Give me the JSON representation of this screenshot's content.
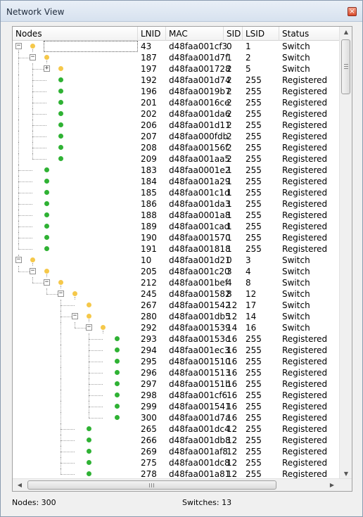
{
  "window": {
    "title": "Network View",
    "close_glyph": "×"
  },
  "columns": [
    {
      "key": "nodes",
      "label": "Nodes"
    },
    {
      "key": "lnid",
      "label": "LNID"
    },
    {
      "key": "mac",
      "label": "MAC"
    },
    {
      "key": "sid",
      "label": "SID"
    },
    {
      "key": "lsid",
      "label": "LSID"
    },
    {
      "key": "status",
      "label": "Status"
    }
  ],
  "colors": {
    "switch_dot": "#f5c84a",
    "registered_dot": "#2fb234"
  },
  "rows": [
    {
      "depth": 0,
      "toggle": "minus",
      "lnid": "43",
      "mac": "d48faa001cf3",
      "sid": "0",
      "lsid": "1",
      "status": "Switch"
    },
    {
      "depth": 1,
      "toggle": "minus",
      "lnid": "187",
      "mac": "d48faa001d7f",
      "sid": "1",
      "lsid": "2",
      "status": "Switch"
    },
    {
      "depth": 2,
      "toggle": "plus",
      "lnid": "197",
      "mac": "d48faa001728",
      "sid": "2",
      "lsid": "5",
      "status": "Switch"
    },
    {
      "depth": 2,
      "toggle": "",
      "lnid": "192",
      "mac": "d48faa001d74",
      "sid": "2",
      "lsid": "255",
      "status": "Registered"
    },
    {
      "depth": 2,
      "toggle": "",
      "lnid": "196",
      "mac": "d48faa0019b7",
      "sid": "2",
      "lsid": "255",
      "status": "Registered"
    },
    {
      "depth": 2,
      "toggle": "",
      "lnid": "201",
      "mac": "d48faa0016ce",
      "sid": "2",
      "lsid": "255",
      "status": "Registered"
    },
    {
      "depth": 2,
      "toggle": "",
      "lnid": "202",
      "mac": "d48faa001da6",
      "sid": "2",
      "lsid": "255",
      "status": "Registered"
    },
    {
      "depth": 2,
      "toggle": "",
      "lnid": "206",
      "mac": "d48faa001d11",
      "sid": "2",
      "lsid": "255",
      "status": "Registered"
    },
    {
      "depth": 2,
      "toggle": "",
      "lnid": "207",
      "mac": "d48faa000fdb",
      "sid": "2",
      "lsid": "255",
      "status": "Registered"
    },
    {
      "depth": 2,
      "toggle": "",
      "lnid": "208",
      "mac": "d48faa00156f",
      "sid": "2",
      "lsid": "255",
      "status": "Registered"
    },
    {
      "depth": 2,
      "toggle": "",
      "lnid": "209",
      "mac": "d48faa001aa5",
      "sid": "2",
      "lsid": "255",
      "status": "Registered"
    },
    {
      "depth": 1,
      "toggle": "",
      "lnid": "183",
      "mac": "d48faa0001e2",
      "sid": "1",
      "lsid": "255",
      "status": "Registered"
    },
    {
      "depth": 1,
      "toggle": "",
      "lnid": "184",
      "mac": "d48faa001a29",
      "sid": "1",
      "lsid": "255",
      "status": "Registered"
    },
    {
      "depth": 1,
      "toggle": "",
      "lnid": "185",
      "mac": "d48faa001c1d",
      "sid": "1",
      "lsid": "255",
      "status": "Registered"
    },
    {
      "depth": 1,
      "toggle": "",
      "lnid": "186",
      "mac": "d48faa001da3",
      "sid": "1",
      "lsid": "255",
      "status": "Registered"
    },
    {
      "depth": 1,
      "toggle": "",
      "lnid": "188",
      "mac": "d48faa0001a8",
      "sid": "1",
      "lsid": "255",
      "status": "Registered"
    },
    {
      "depth": 1,
      "toggle": "",
      "lnid": "189",
      "mac": "d48faa001cad",
      "sid": "1",
      "lsid": "255",
      "status": "Registered"
    },
    {
      "depth": 1,
      "toggle": "",
      "lnid": "190",
      "mac": "d48faa001570",
      "sid": "1",
      "lsid": "255",
      "status": "Registered"
    },
    {
      "depth": 1,
      "toggle": "",
      "lnid": "191",
      "mac": "d48faa001818",
      "sid": "1",
      "lsid": "255",
      "status": "Registered"
    },
    {
      "depth": 0,
      "toggle": "minus",
      "lnid": "10",
      "mac": "d48faa001d21",
      "sid": "0",
      "lsid": "3",
      "status": "Switch"
    },
    {
      "depth": 1,
      "toggle": "minus",
      "lnid": "205",
      "mac": "d48faa001c20",
      "sid": "3",
      "lsid": "4",
      "status": "Switch"
    },
    {
      "depth": 2,
      "toggle": "minus",
      "lnid": "212",
      "mac": "d48faa001bef",
      "sid": "4",
      "lsid": "8",
      "status": "Switch"
    },
    {
      "depth": 3,
      "toggle": "minus",
      "lnid": "245",
      "mac": "d48faa001582",
      "sid": "8",
      "lsid": "12",
      "status": "Switch"
    },
    {
      "depth": 4,
      "toggle": "",
      "lnid": "267",
      "mac": "d48faa001542",
      "sid": "12",
      "lsid": "17",
      "status": "Switch"
    },
    {
      "depth": 4,
      "toggle": "minus",
      "lnid": "280",
      "mac": "d48faa001db5",
      "sid": "12",
      "lsid": "14",
      "status": "Switch"
    },
    {
      "depth": 5,
      "toggle": "minus",
      "lnid": "292",
      "mac": "d48faa001539",
      "sid": "14",
      "lsid": "16",
      "status": "Switch"
    },
    {
      "depth": 6,
      "toggle": "",
      "lnid": "293",
      "mac": "d48faa00153d",
      "sid": "16",
      "lsid": "255",
      "status": "Registered"
    },
    {
      "depth": 6,
      "toggle": "",
      "lnid": "294",
      "mac": "d48faa001ec3",
      "sid": "16",
      "lsid": "255",
      "status": "Registered"
    },
    {
      "depth": 6,
      "toggle": "",
      "lnid": "295",
      "mac": "d48faa001510",
      "sid": "16",
      "lsid": "255",
      "status": "Registered"
    },
    {
      "depth": 6,
      "toggle": "",
      "lnid": "296",
      "mac": "d48faa001513",
      "sid": "16",
      "lsid": "255",
      "status": "Registered"
    },
    {
      "depth": 6,
      "toggle": "",
      "lnid": "297",
      "mac": "d48faa00151b",
      "sid": "16",
      "lsid": "255",
      "status": "Registered"
    },
    {
      "depth": 6,
      "toggle": "",
      "lnid": "298",
      "mac": "d48faa001cf6",
      "sid": "16",
      "lsid": "255",
      "status": "Registered"
    },
    {
      "depth": 6,
      "toggle": "",
      "lnid": "299",
      "mac": "d48faa001541",
      "sid": "16",
      "lsid": "255",
      "status": "Registered"
    },
    {
      "depth": 6,
      "toggle": "",
      "lnid": "300",
      "mac": "d48faa001d7a",
      "sid": "16",
      "lsid": "255",
      "status": "Registered"
    },
    {
      "depth": 4,
      "toggle": "",
      "lnid": "265",
      "mac": "d48faa001dc4",
      "sid": "12",
      "lsid": "255",
      "status": "Registered"
    },
    {
      "depth": 4,
      "toggle": "",
      "lnid": "266",
      "mac": "d48faa001db8",
      "sid": "12",
      "lsid": "255",
      "status": "Registered"
    },
    {
      "depth": 4,
      "toggle": "",
      "lnid": "269",
      "mac": "d48faa001af8",
      "sid": "12",
      "lsid": "255",
      "status": "Registered"
    },
    {
      "depth": 4,
      "toggle": "",
      "lnid": "275",
      "mac": "d48faa001dc8",
      "sid": "12",
      "lsid": "255",
      "status": "Registered"
    },
    {
      "depth": 4,
      "toggle": "",
      "lnid": "278",
      "mac": "d48faa001a81",
      "sid": "12",
      "lsid": "255",
      "status": "Registered"
    }
  ],
  "statusbar": {
    "nodes_text": "Nodes: 300",
    "switches_text": "Switches: 13"
  }
}
